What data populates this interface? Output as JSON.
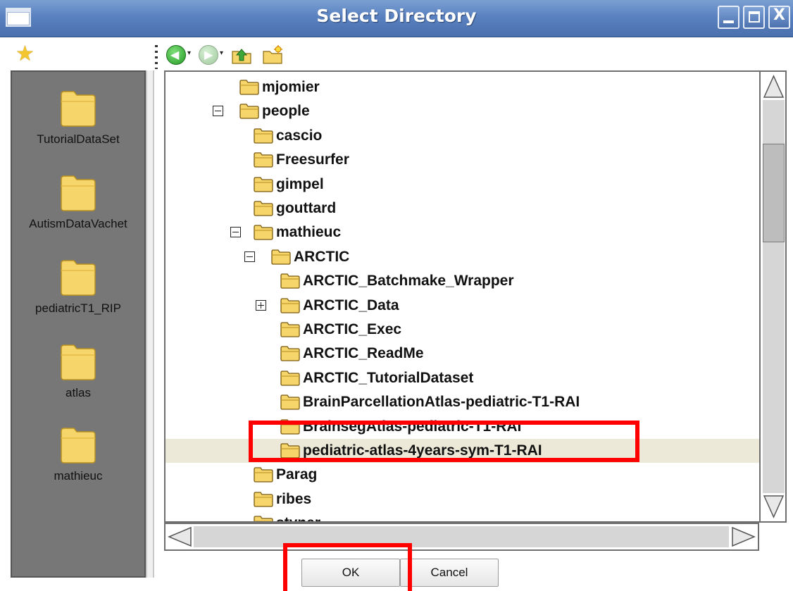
{
  "window": {
    "title": "Select Directory",
    "controls": [
      "minimize",
      "maximize",
      "close"
    ],
    "close_glyph": "X"
  },
  "toolbar": {
    "bookmark_icon": "star-icon",
    "back_icon": "back-arrow-icon",
    "forward_icon": "forward-arrow-icon",
    "parent_folder_icon": "folder-up-icon",
    "new_folder_icon": "new-folder-icon",
    "dropdown_glyph": "▾"
  },
  "sidebar": {
    "places": [
      {
        "label": "TutorialDataSet"
      },
      {
        "label": "AutismDataVachet"
      },
      {
        "label": "pediatricT1_RIP"
      },
      {
        "label": "atlas"
      },
      {
        "label": "mathieuc"
      }
    ]
  },
  "tree": {
    "rows": [
      {
        "label": "mjomier",
        "depth": 1,
        "expander": "none",
        "selected": false
      },
      {
        "label": "people",
        "depth": 1,
        "expander": "minus",
        "selected": false
      },
      {
        "label": "cascio",
        "depth": 2,
        "expander": "none",
        "selected": false
      },
      {
        "label": "Freesurfer",
        "depth": 2,
        "expander": "none",
        "selected": false
      },
      {
        "label": "gimpel",
        "depth": 2,
        "expander": "none",
        "selected": false
      },
      {
        "label": "gouttard",
        "depth": 2,
        "expander": "none",
        "selected": false
      },
      {
        "label": "mathieuc",
        "depth": 2,
        "expander": "minus",
        "selected": false
      },
      {
        "label": "ARCTIC",
        "depth": 3,
        "expander": "minus",
        "selected": false
      },
      {
        "label": "ARCTIC_Batchmake_Wrapper",
        "depth": 4,
        "expander": "none",
        "selected": false
      },
      {
        "label": "ARCTIC_Data",
        "depth": 4,
        "expander": "plus",
        "selected": false
      },
      {
        "label": "ARCTIC_Exec",
        "depth": 4,
        "expander": "none",
        "selected": false
      },
      {
        "label": "ARCTIC_ReadMe",
        "depth": 4,
        "expander": "none",
        "selected": false
      },
      {
        "label": "ARCTIC_TutorialDataset",
        "depth": 4,
        "expander": "none",
        "selected": false
      },
      {
        "label": "BrainParcellationAtlas-pediatric-T1-RAI",
        "depth": 4,
        "expander": "none",
        "selected": false
      },
      {
        "label": "BrainsegAtlas-pediatric-T1-RAI",
        "depth": 4,
        "expander": "none",
        "selected": false
      },
      {
        "label": "pediatric-atlas-4years-sym-T1-RAI",
        "depth": 4,
        "expander": "none",
        "selected": true
      },
      {
        "label": "Parag",
        "depth": 2,
        "expander": "none",
        "selected": false
      },
      {
        "label": "ribes",
        "depth": 2,
        "expander": "none",
        "selected": false
      },
      {
        "label": "styner",
        "depth": 2,
        "expander": "none",
        "selected": false
      }
    ]
  },
  "buttons": {
    "ok_label": "OK",
    "cancel_label": "Cancel"
  },
  "colors": {
    "title_bar": "#5a82c0",
    "sidebar_bg": "#777777",
    "selection_bg": "#ece9d8",
    "highlight": "#ff0000",
    "folder_fill": "#f6d66a"
  }
}
